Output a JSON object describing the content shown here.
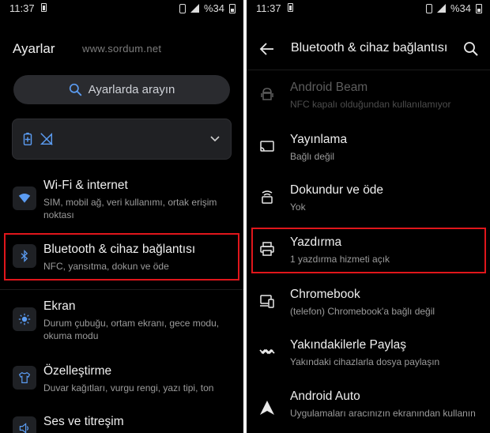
{
  "status": {
    "time": "11:37",
    "battery": "%34"
  },
  "left": {
    "title": "Ayarlar",
    "watermark": "www.sordum.net",
    "search_placeholder": "Ayarlarda arayın",
    "items": [
      {
        "title": "Wi-Fi & internet",
        "subtitle": "SIM, mobil ağ, veri kullanımı, ortak erişim noktası"
      },
      {
        "title": "Bluetooth & cihaz bağlantısı",
        "subtitle": "NFC, yansıtma, dokun ve öde"
      },
      {
        "title": "Ekran",
        "subtitle": "Durum çubuğu, ortam ekranı, gece modu, okuma modu"
      },
      {
        "title": "Özelleştirme",
        "subtitle": "Duvar kağıtları, vurgu rengi, yazı tipi, ton"
      },
      {
        "title": "Ses ve titreşim",
        "subtitle": ""
      }
    ]
  },
  "right": {
    "title": "Bluetooth & cihaz bağlantısı",
    "items": [
      {
        "title": "Android Beam",
        "subtitle": "NFC kapalı olduğundan kullanılamıyor"
      },
      {
        "title": "Yayınlama",
        "subtitle": "Bağlı değil"
      },
      {
        "title": "Dokundur ve öde",
        "subtitle": "Yok"
      },
      {
        "title": "Yazdırma",
        "subtitle": "1 yazdırma hizmeti açık"
      },
      {
        "title": "Chromebook",
        "subtitle": "(telefon) Chromebook'a bağlı değil"
      },
      {
        "title": "Yakındakilerle Paylaş",
        "subtitle": "Yakındaki cihazlarla dosya paylaşın"
      },
      {
        "title": "Android Auto",
        "subtitle": "Uygulamaları aracınızın ekranından kullanın"
      }
    ]
  },
  "colors": {
    "highlight": "#e0161b",
    "accent": "#5b9cf2",
    "background": "#000000"
  }
}
